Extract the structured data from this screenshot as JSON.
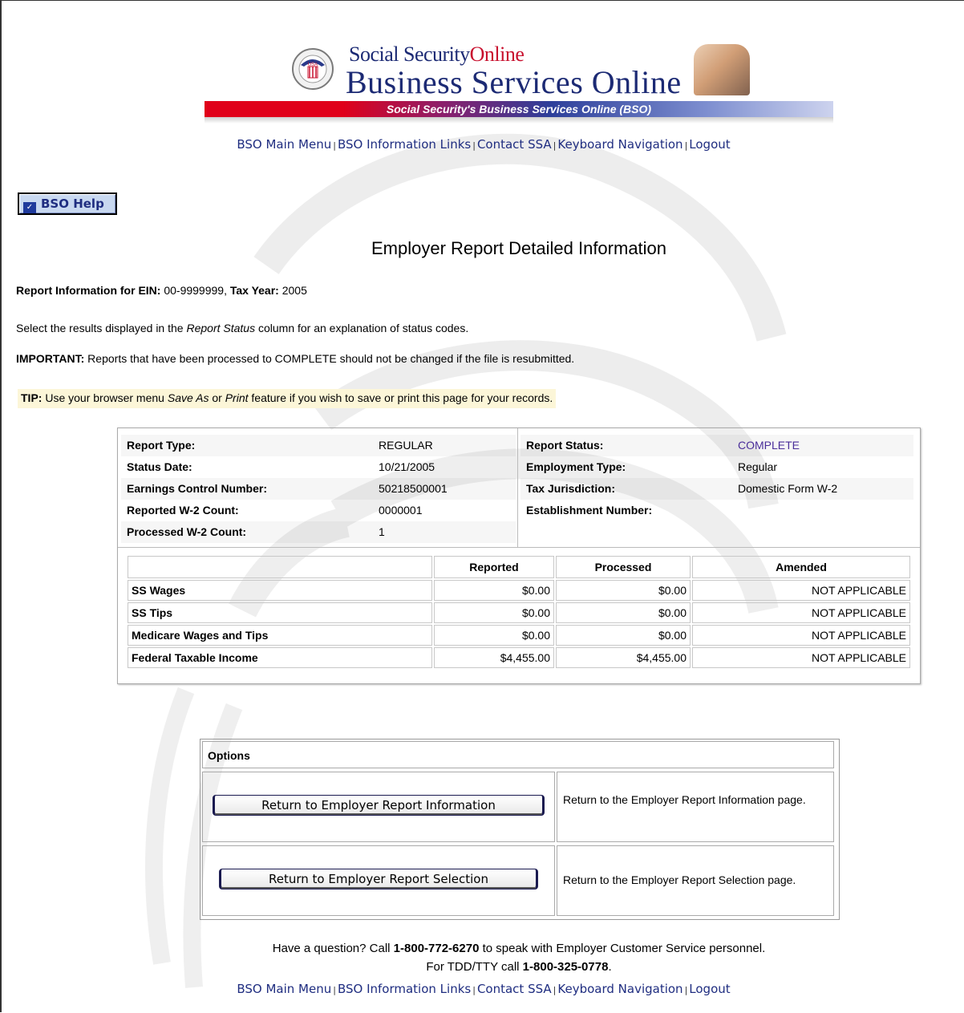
{
  "header": {
    "brand_top_a": "Social Security",
    "brand_top_b": "Online",
    "brand_main": "Business Services Online",
    "banner": "Social Security's Business Services Online (BSO)",
    "seal_text": "USA"
  },
  "nav": {
    "items": [
      "BSO Main Menu",
      "BSO Information Links",
      "Contact SSA",
      "Keyboard Navigation",
      "Logout"
    ],
    "separator": "|"
  },
  "help_button": "BSO Help",
  "page_title": "Employer Report Detailed Information",
  "report_info": {
    "prefix": "Report Information for ",
    "ein_label": "EIN:",
    "ein_value": "00-9999999",
    "comma": ", ",
    "year_label": "Tax Year:",
    "year_value": "2005"
  },
  "select_para": {
    "a": "Select the results displayed in the ",
    "em": "Report Status",
    "b": " column for an explanation of status codes."
  },
  "important": {
    "label": "IMPORTANT:",
    "text": " Reports that have been processed to COMPLETE should not be changed if the file is resubmitted."
  },
  "tip": {
    "label": "TIP:",
    "a": " Use your browser menu ",
    "em1": "Save As",
    "b": " or ",
    "em2": "Print",
    "c": " feature if you wish to save or print this page for your records."
  },
  "details_left": [
    {
      "label": "Report Type:",
      "value": "REGULAR"
    },
    {
      "label": "Status Date:",
      "value": "10/21/2005"
    },
    {
      "label": "Earnings Control Number:",
      "value": "50218500001"
    },
    {
      "label": "Reported W-2 Count:",
      "value": "0000001"
    },
    {
      "label": "Processed W-2 Count:",
      "value": "1"
    }
  ],
  "details_right": [
    {
      "label": "Report Status:",
      "value": "COMPLETE"
    },
    {
      "label": "Employment Type:",
      "value": "Regular"
    },
    {
      "label": "Tax Jurisdiction:",
      "value": "Domestic Form W-2"
    },
    {
      "label": "Establishment Number:",
      "value": ""
    }
  ],
  "amounts": {
    "headers": [
      "",
      "Reported",
      "Processed",
      "Amended"
    ],
    "rows": [
      [
        "SS Wages",
        "$0.00",
        "$0.00",
        "NOT APPLICABLE"
      ],
      [
        "SS Tips",
        "$0.00",
        "$0.00",
        "NOT APPLICABLE"
      ],
      [
        "Medicare Wages and Tips",
        "$0.00",
        "$0.00",
        "NOT APPLICABLE"
      ],
      [
        "Federal Taxable Income",
        "$4,455.00",
        "$4,455.00",
        "NOT APPLICABLE"
      ]
    ]
  },
  "options": {
    "title": "Options",
    "items": [
      {
        "button": "Return to Employer Report Information",
        "description": "Return to the Employer Report Information page."
      },
      {
        "button": "Return to Employer Report Selection",
        "description": "Return to the Employer Report Selection page."
      }
    ]
  },
  "footer": {
    "q_a": "Have a question? Call ",
    "q_phone": "1-800-772-6270",
    "q_b": " to speak with Employer Customer Service personnel.",
    "tdd_a": "For TDD/TTY call ",
    "tdd_phone": "1-800-325-0778",
    "tdd_b": "."
  },
  "colors": {
    "nav_link": "#1f2d80",
    "status_link": "#4a2e9a",
    "banner_red": "#e0001a",
    "banner_blue": "#2d3f9a"
  }
}
